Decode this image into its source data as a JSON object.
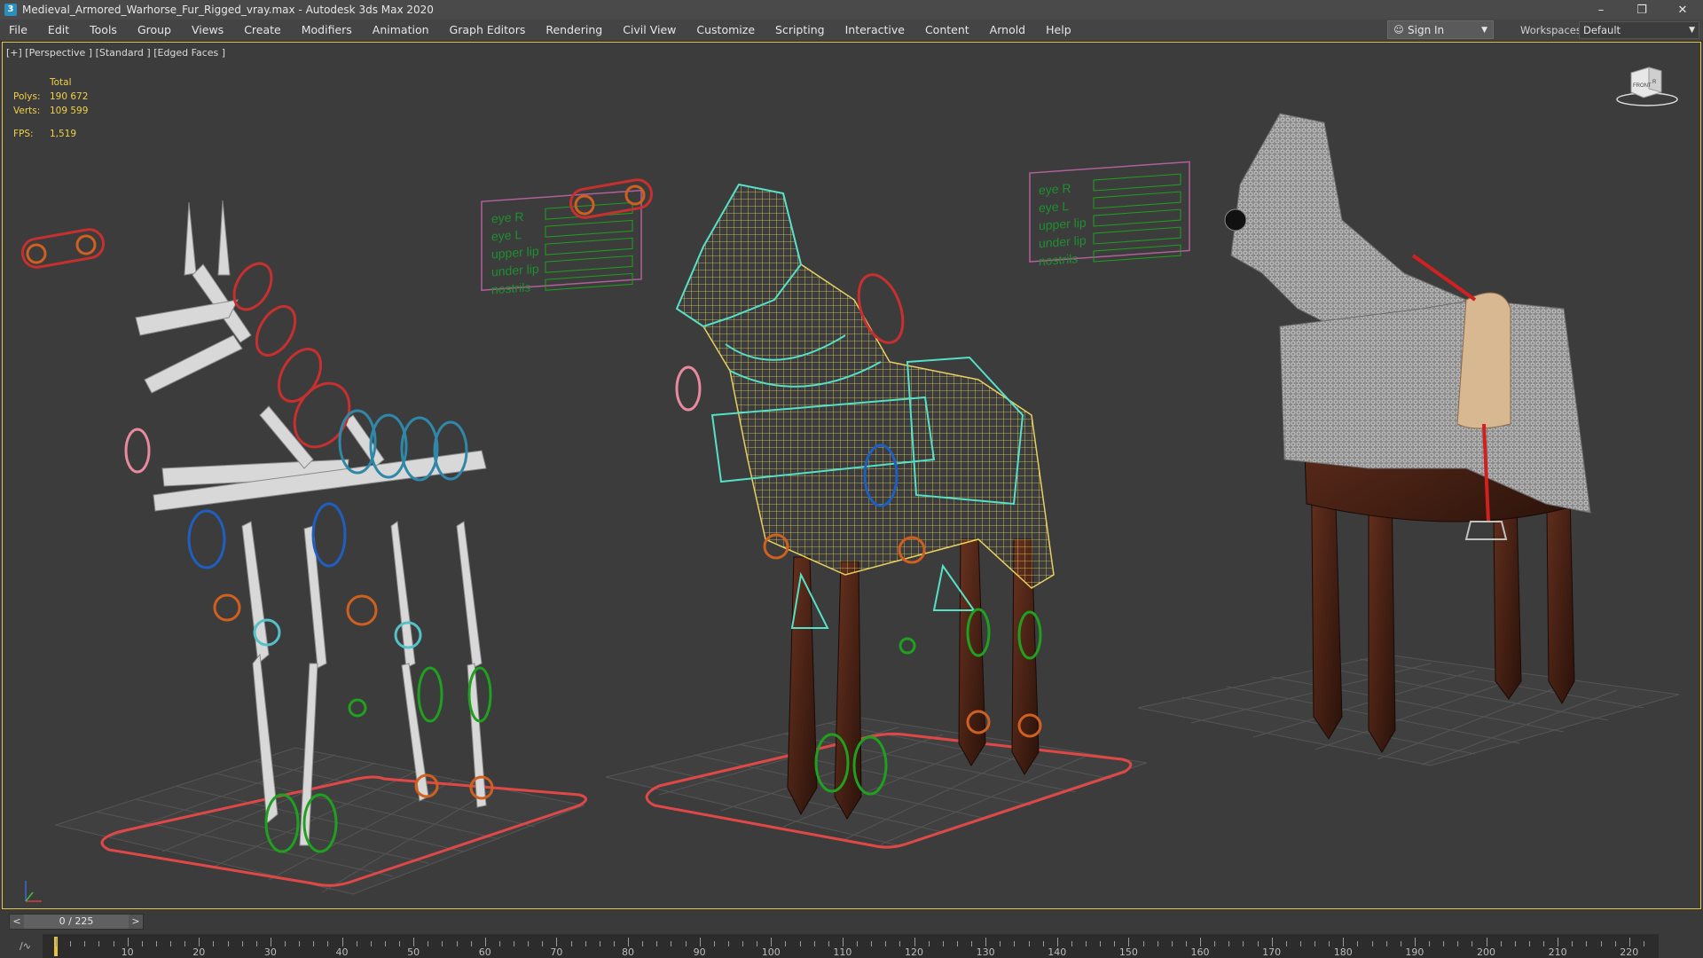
{
  "window": {
    "title": "Medieval_Armored_Warhorse_Fur_Rigged_vray.max - Autodesk 3ds Max 2020",
    "app_icon": "3",
    "minimize": "–",
    "restore": "❐",
    "close": "✕"
  },
  "menu": {
    "items": [
      "File",
      "Edit",
      "Tools",
      "Group",
      "Views",
      "Create",
      "Modifiers",
      "Animation",
      "Graph Editors",
      "Rendering",
      "Civil View",
      "Customize",
      "Scripting",
      "Interactive",
      "Content",
      "Arnold",
      "Help"
    ]
  },
  "account": {
    "sign_in": "Sign In"
  },
  "workspaces": {
    "label": "Workspaces:",
    "value": "Default"
  },
  "viewport": {
    "label": "[+] [Perspective ] [Standard ] [Edged Faces ]",
    "stats": {
      "header": "Total",
      "polys_label": "Polys:",
      "polys": "190 672",
      "verts_label": "Verts:",
      "verts": "109 599",
      "fps_label": "FPS:",
      "fps": "1,519"
    },
    "viewcube": {
      "front": "FRONT",
      "right": "R"
    },
    "face_panels": [
      {
        "rows": [
          "eye R",
          "eye L",
          "upper lip",
          "under lip",
          "nostrils"
        ]
      },
      {
        "rows": [
          "eye R",
          "eye L",
          "upper lip",
          "under lip",
          "nostrils"
        ]
      }
    ]
  },
  "timeline": {
    "slider": "0 / 225",
    "prev": "<",
    "next": ">",
    "ticks": [
      "10",
      "20",
      "30",
      "40",
      "50",
      "60",
      "70",
      "80",
      "90",
      "100",
      "110",
      "120",
      "130",
      "140",
      "150",
      "160",
      "170",
      "180",
      "190",
      "200",
      "210",
      "220"
    ]
  },
  "colors": {
    "accent": "#e6c64a",
    "stats_text": "#f0d04a",
    "rig_red": "#d23a3a",
    "rig_blue": "#1f5fbf",
    "rig_teal": "#2f88a8",
    "rig_green": "#1fa01f",
    "rig_orange": "#d06020",
    "wire_yellow": "#e8d060",
    "wire_cyan": "#55e0c8",
    "panel_border": "#b0609a",
    "panel_label": "#1f8f2f"
  }
}
